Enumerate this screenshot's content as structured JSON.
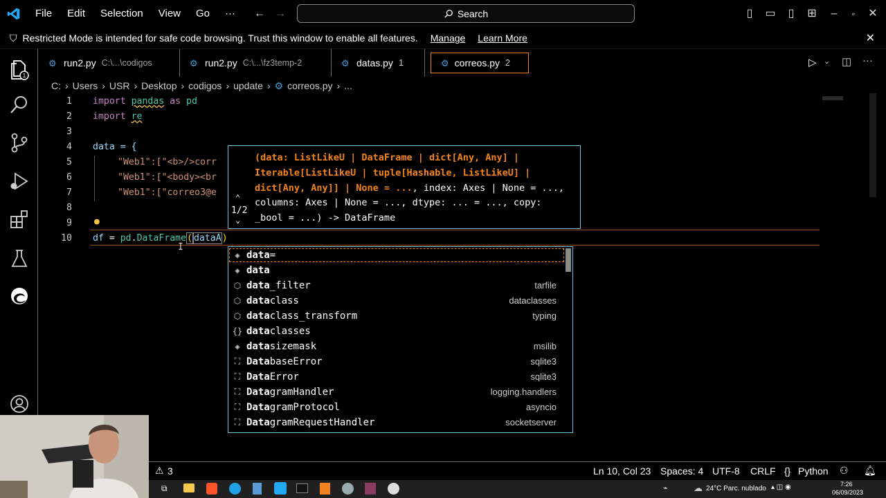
{
  "titlebar": {
    "menu": [
      "File",
      "Edit",
      "Selection",
      "View",
      "Go",
      "···"
    ],
    "search": "Search"
  },
  "banner": {
    "message": "Restricted Mode is intended for safe code browsing. Trust this window to enable all features.",
    "manage": "Manage",
    "learn_more": "Learn More"
  },
  "tabs": [
    {
      "name": "run2.py",
      "desc": "C:\\...\\codigos",
      "count": ""
    },
    {
      "name": "run2.py",
      "desc": "C:\\...\\fz3temp-2",
      "count": ""
    },
    {
      "name": "datas.py",
      "desc": "",
      "count": "1"
    },
    {
      "name": "correos.py",
      "desc": "",
      "count": "2"
    }
  ],
  "breadcrumb": [
    "C:",
    "Users",
    "USR",
    "Desktop",
    "codigos",
    "update",
    "correos.py",
    "..."
  ],
  "line_numbers": [
    "1",
    "2",
    "3",
    "4",
    "5",
    "6",
    "7",
    "8",
    "9",
    "10"
  ],
  "code": {
    "l1_kw": "import",
    "l1_mod": "pandas",
    "l1_as": "as",
    "l1_alias": "pd",
    "l2_kw": "import",
    "l2_mod": "re",
    "l4": "data = {",
    "l5_key": "\"Web1\"",
    "l5_rest": ":[\"<b>/>corr",
    "l6_key": "\"Web1\"",
    "l6_rest": ":[\"<body><br",
    "l7_key": "\"Web1\"",
    "l7_rest": ":[\"correo3@e",
    "l10_var": "df",
    "l10_eq": " = ",
    "l10_pd": "pd",
    "l10_cls": "DataFrame",
    "l10_arg": "dataA"
  },
  "signature": {
    "counter": "1/2",
    "param": "(data: ListLikeU | DataFrame | dict[Any, Any] | Iterable[ListLikeU | tuple[Hashable, ListLikeU] | dict[Any, Any]] | None = ...",
    "rest": ", index: Axes | None = ..., columns: Axes | None = ..., dtype: ... = ..., copy: _bool = ...) -> DataFrame"
  },
  "suggestions": [
    {
      "icon": "◈",
      "match": "data",
      "rest": "=",
      "detail": ""
    },
    {
      "icon": "◈",
      "match": "data",
      "rest": "",
      "detail": ""
    },
    {
      "icon": "⬡",
      "match": "data",
      "rest": "_filter",
      "detail": "tarfile"
    },
    {
      "icon": "⬡",
      "match": "data",
      "rest": "class",
      "detail": "dataclasses"
    },
    {
      "icon": "⬡",
      "match": "data",
      "rest": "class_transform",
      "detail": "typing"
    },
    {
      "icon": "{}",
      "match": "data",
      "rest": "classes",
      "detail": ""
    },
    {
      "icon": "◈",
      "match": "data",
      "rest": "sizemask",
      "detail": "msilib"
    },
    {
      "icon": "⛶",
      "match": "Data",
      "rest": "baseError",
      "detail": "sqlite3"
    },
    {
      "icon": "⛶",
      "match": "Data",
      "rest": "Error",
      "detail": "sqlite3"
    },
    {
      "icon": "⛶",
      "match": "Data",
      "rest": "gramHandler",
      "detail": "logging.handlers"
    },
    {
      "icon": "⛶",
      "match": "Data",
      "rest": "gramProtocol",
      "detail": "asyncio"
    },
    {
      "icon": "⛶",
      "match": "Data",
      "rest": "gramRequestHandler",
      "detail": "socketserver"
    }
  ],
  "statusbar": {
    "problems_warn": "3",
    "position": "Ln 10, Col 23",
    "spaces": "Spaces: 4",
    "encoding": "UTF-8",
    "eol": "CRLF",
    "language": "Python"
  },
  "taskbar": {
    "weather": "24°C Parc. nublado",
    "time": "7:26",
    "date": "06/09/2023"
  },
  "colors": {
    "accent_border": "#f38518",
    "widget_border": "#6fc3df",
    "vscode_blue": "#23a9f2"
  }
}
